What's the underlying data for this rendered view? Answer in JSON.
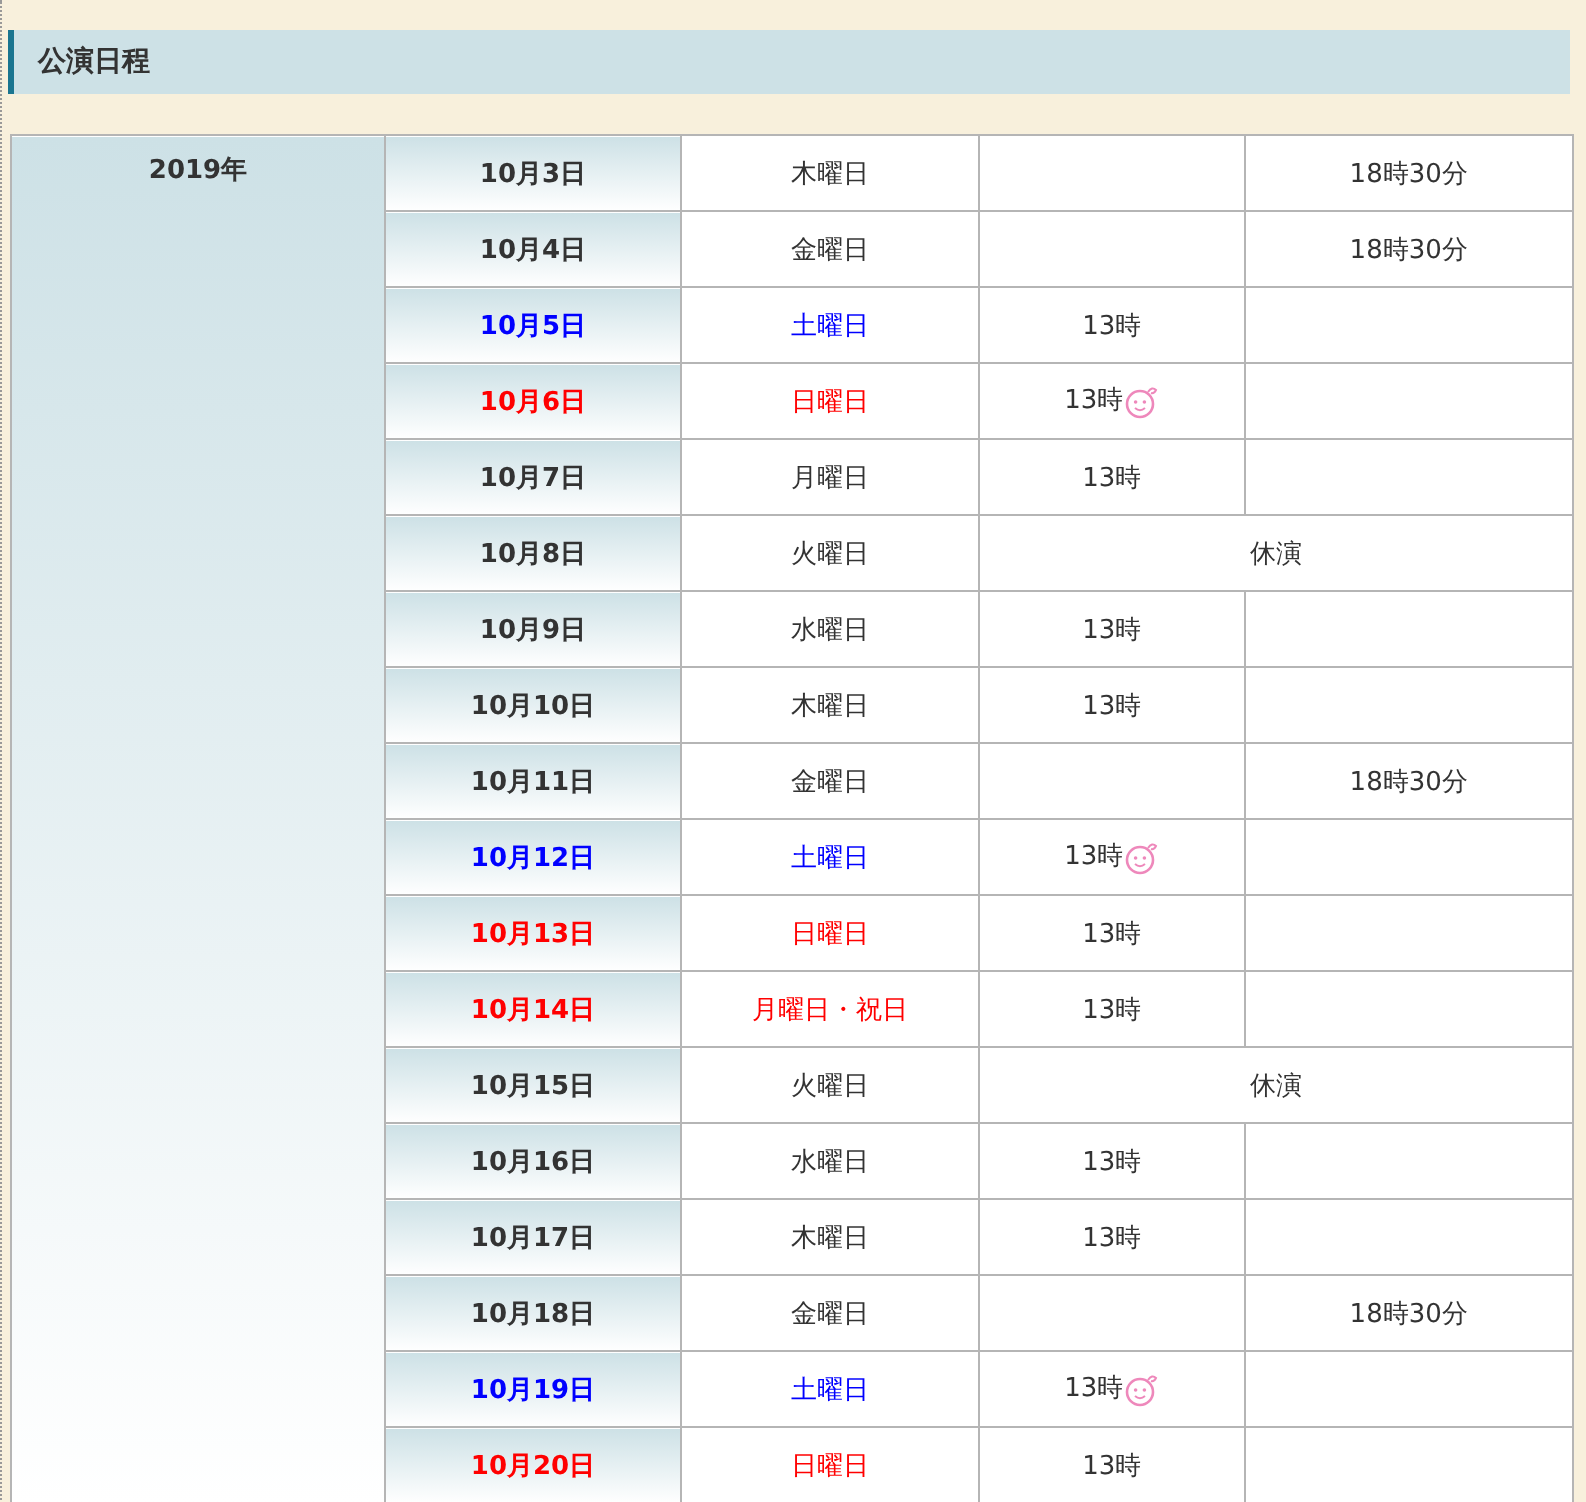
{
  "section": {
    "title": "公演日程"
  },
  "schedule": {
    "year": "2019年",
    "rows": [
      {
        "date": "10月3日",
        "weekday": "木曜日",
        "color": "#333333",
        "kind": "show",
        "evening": "18時30分"
      },
      {
        "date": "10月4日",
        "weekday": "金曜日",
        "color": "#333333",
        "kind": "show",
        "evening": "18時30分"
      },
      {
        "date": "10月5日",
        "weekday": "土曜日",
        "color": "#0000ff",
        "kind": "show",
        "matinee": "13時",
        "matinee_icon": false
      },
      {
        "date": "10月6日",
        "weekday": "日曜日",
        "color": "#ff0000",
        "kind": "show",
        "matinee": "13時",
        "matinee_icon": true
      },
      {
        "date": "10月7日",
        "weekday": "月曜日",
        "color": "#333333",
        "kind": "show",
        "matinee": "13時",
        "matinee_icon": false
      },
      {
        "date": "10月8日",
        "weekday": "火曜日",
        "color": "#333333",
        "kind": "closed",
        "note": "休演"
      },
      {
        "date": "10月9日",
        "weekday": "水曜日",
        "color": "#333333",
        "kind": "show",
        "matinee": "13時",
        "matinee_icon": false
      },
      {
        "date": "10月10日",
        "weekday": "木曜日",
        "color": "#333333",
        "kind": "show",
        "matinee": "13時",
        "matinee_icon": false
      },
      {
        "date": "10月11日",
        "weekday": "金曜日",
        "color": "#333333",
        "kind": "show",
        "evening": "18時30分"
      },
      {
        "date": "10月12日",
        "weekday": "土曜日",
        "color": "#0000ff",
        "kind": "show",
        "matinee": "13時",
        "matinee_icon": true
      },
      {
        "date": "10月13日",
        "weekday": "日曜日",
        "color": "#ff0000",
        "kind": "show",
        "matinee": "13時",
        "matinee_icon": false
      },
      {
        "date": "10月14日",
        "weekday": "月曜日・祝日",
        "color": "#ff0000",
        "kind": "show",
        "matinee": "13時",
        "matinee_icon": false
      },
      {
        "date": "10月15日",
        "weekday": "火曜日",
        "color": "#333333",
        "kind": "closed",
        "note": "休演"
      },
      {
        "date": "10月16日",
        "weekday": "水曜日",
        "color": "#333333",
        "kind": "show",
        "matinee": "13時",
        "matinee_icon": false
      },
      {
        "date": "10月17日",
        "weekday": "木曜日",
        "color": "#333333",
        "kind": "show",
        "matinee": "13時",
        "matinee_icon": false
      },
      {
        "date": "10月18日",
        "weekday": "金曜日",
        "color": "#333333",
        "kind": "show",
        "evening": "18時30分"
      },
      {
        "date": "10月19日",
        "weekday": "土曜日",
        "color": "#0000ff",
        "kind": "show",
        "matinee": "13時",
        "matinee_icon": true
      },
      {
        "date": "10月20日",
        "weekday": "日曜日",
        "color": "#ff0000",
        "kind": "show",
        "matinee": "13時",
        "matinee_icon": false
      }
    ]
  }
}
